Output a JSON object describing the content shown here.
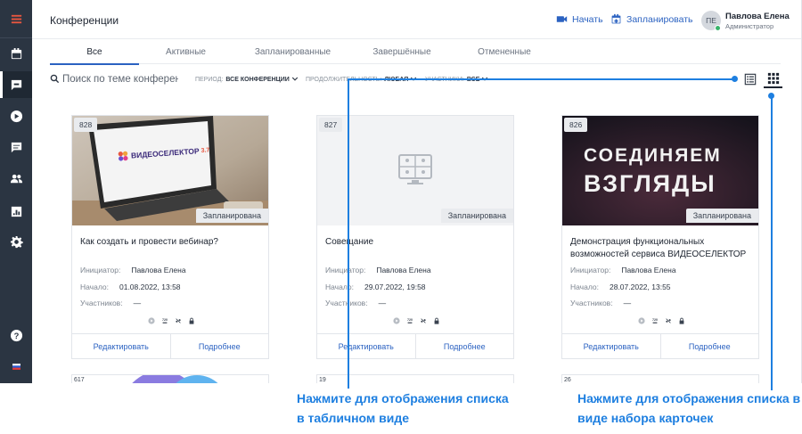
{
  "header": {
    "title": "Конференции",
    "start_label": "Начать",
    "schedule_label": "Запланировать",
    "user": {
      "initials": "ПЕ",
      "name": "Павлова Елена",
      "role": "Администратор"
    }
  },
  "tabs": [
    {
      "label": "Все",
      "active": true
    },
    {
      "label": "Активные",
      "active": false
    },
    {
      "label": "Запланированные",
      "active": false
    },
    {
      "label": "Завершённые",
      "active": false
    },
    {
      "label": "Отмененные",
      "active": false
    }
  ],
  "search": {
    "placeholder": "Поиск по теме конференции"
  },
  "filters": [
    {
      "label": "ПЕРИОД:",
      "value": "ВСЕ КОНФЕРЕНЦИИ"
    },
    {
      "label": "ПРОДОЛЖИТЕЛЬНОСТЬ:",
      "value": "ЛЮБАЯ"
    },
    {
      "label": "УЧАСТНИКИ:",
      "value": "ВСЕ"
    }
  ],
  "labels": {
    "initiator": "Инициатор:",
    "start": "Начало:",
    "participants": "Участников:",
    "edit": "Редактировать",
    "details": "Подробнее"
  },
  "cards": [
    {
      "id": "828",
      "status": "Запланирована",
      "title": "Как создать и провести вебинар?",
      "initiator": "Павлова Елена",
      "start": "01.08.2022, 13:58",
      "participants": "—",
      "logo_text": "ВИДЕОСЕЛЕКТОР",
      "logo_suffix": "3.7"
    },
    {
      "id": "827",
      "status": "Запланирована",
      "title": "Совещание",
      "initiator": "Павлова Елена",
      "start": "29.07.2022, 19:58",
      "participants": "—"
    },
    {
      "id": "826",
      "status": "Запланирована",
      "title": "Демонстрация функциональных возможностей сервиса ВИДЕОСЕЛЕКТОР",
      "initiator": "Павлова Елена",
      "start": "28.07.2022, 13:55",
      "participants": "—",
      "banner_line1": "СОЕДИНЯЕМ",
      "banner_line2": "ВЗГЛЯДЫ"
    }
  ],
  "next_row_ids": [
    "617",
    "19",
    "26"
  ],
  "callouts": {
    "table_view": "Нажмите для отображения списка в табличном виде",
    "cards_view": "Нажмите для отображения списка в виде набора карточек"
  },
  "icons": [
    "menu-icon",
    "calendar-icon",
    "conference-icon",
    "play-icon",
    "chat-icon",
    "users-icon",
    "stats-icon",
    "settings-icon",
    "help-icon",
    "flag-icon",
    "video-camera-icon",
    "calendar-plus-icon",
    "search-icon",
    "chevron-down-icon",
    "list-view-icon",
    "grid-view-icon",
    "recording-icon",
    "hd-icon",
    "no-link-icon",
    "lock-icon"
  ],
  "colors": {
    "sidebar": "#2b3542",
    "accent": "#2b62c1",
    "callout": "#1e7fe0",
    "online": "#38b36a"
  }
}
